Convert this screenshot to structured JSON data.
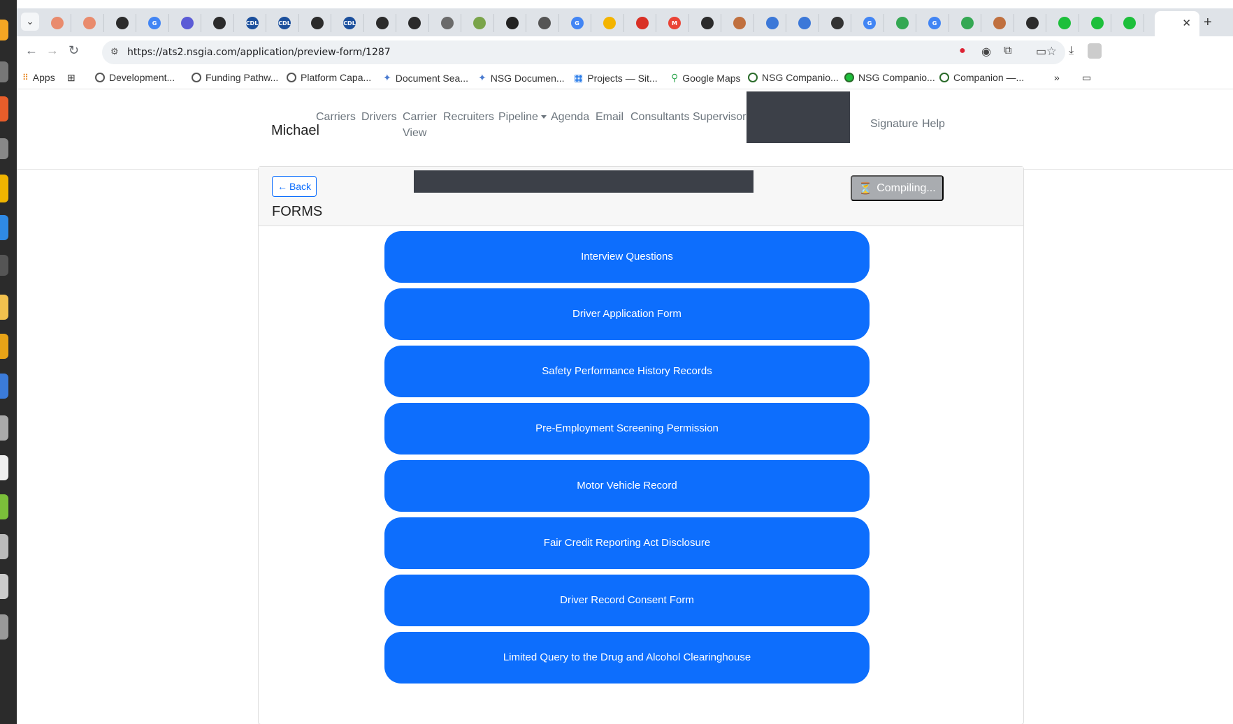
{
  "browser": {
    "tabs": [
      {
        "icon": "recording-icon",
        "color": "#e98b6d",
        "text": ""
      },
      {
        "icon": "recording-icon",
        "color": "#e98b6d",
        "text": ""
      },
      {
        "icon": "chat-icon",
        "color": "#2b2b2b",
        "text": ""
      },
      {
        "icon": "google-icon",
        "color": "#4285f4",
        "text": "G"
      },
      {
        "icon": "app-icon",
        "color": "#5b5bd6",
        "text": ""
      },
      {
        "icon": "chat-icon",
        "color": "#2b2b2b",
        "text": ""
      },
      {
        "icon": "cdl-icon",
        "color": "#1b4f9c",
        "text": "CDL"
      },
      {
        "icon": "cdl-icon",
        "color": "#1b4f9c",
        "text": "CDL"
      },
      {
        "icon": "chat-icon",
        "color": "#2b2b2b",
        "text": ""
      },
      {
        "icon": "cdl-icon",
        "color": "#1b4f9c",
        "text": "CDL"
      },
      {
        "icon": "chat-icon",
        "color": "#2b2b2b",
        "text": ""
      },
      {
        "icon": "chat-icon",
        "color": "#2b2b2b",
        "text": ""
      },
      {
        "icon": "calendar-icon",
        "color": "#6b6b6b",
        "text": ""
      },
      {
        "icon": "map-icon",
        "color": "#7aa44a",
        "text": ""
      },
      {
        "icon": "openai-icon",
        "color": "#222222",
        "text": ""
      },
      {
        "icon": "openai-icon",
        "color": "#555555",
        "text": ""
      },
      {
        "icon": "google-icon",
        "color": "#4285f4",
        "text": "G"
      },
      {
        "icon": "analytics-icon",
        "color": "#f4b400",
        "text": ""
      },
      {
        "icon": "record-icon",
        "color": "#d93025",
        "text": ""
      },
      {
        "icon": "gmail-icon",
        "color": "#ea4335",
        "text": "M"
      },
      {
        "icon": "chat-icon",
        "color": "#2b2b2b",
        "text": ""
      },
      {
        "icon": "app-icon",
        "color": "#c0703f",
        "text": ""
      },
      {
        "icon": "app-icon",
        "color": "#3c78d8",
        "text": ""
      },
      {
        "icon": "app-icon",
        "color": "#3c78d8",
        "text": ""
      },
      {
        "icon": "github-icon",
        "color": "#333333",
        "text": ""
      },
      {
        "icon": "google-icon",
        "color": "#4285f4",
        "text": "G"
      },
      {
        "icon": "maps-icon",
        "color": "#34a853",
        "text": ""
      },
      {
        "icon": "google-icon",
        "color": "#4285f4",
        "text": "G"
      },
      {
        "icon": "maps-icon",
        "color": "#34a853",
        "text": ""
      },
      {
        "icon": "app-icon",
        "color": "#c0703f",
        "text": ""
      },
      {
        "icon": "chat-icon",
        "color": "#2b2b2b",
        "text": ""
      },
      {
        "icon": "dot-icon",
        "color": "#1dbf3b",
        "text": ""
      },
      {
        "icon": "dot-icon",
        "color": "#1dbf3b",
        "text": ""
      },
      {
        "icon": "dot-icon",
        "color": "#1dbf3b",
        "text": ""
      }
    ],
    "url": "https://ats2.nsgia.com/application/preview-form/1287",
    "bookmarks": [
      {
        "label": "Apps"
      },
      {
        "label": ""
      },
      {
        "label": "Development..."
      },
      {
        "label": "Funding Pathw..."
      },
      {
        "label": "Platform Capa..."
      },
      {
        "label": "Document Sea..."
      },
      {
        "label": "NSG Documen..."
      },
      {
        "label": "Projects — Sit..."
      },
      {
        "label": "Google Maps"
      },
      {
        "label": "NSG Companio..."
      },
      {
        "label": "NSG Companio..."
      },
      {
        "label": "Companion —..."
      }
    ],
    "bookmarks_more": "»"
  },
  "navbar": {
    "brand": "Michael",
    "links": [
      "Carriers",
      "Drivers",
      "Carrier",
      "View",
      "Recruiters",
      "Pipeline",
      "Agenda",
      "Email",
      "Consultants",
      "Supervisor",
      "Signature",
      "Help"
    ]
  },
  "card": {
    "back_label": "Back",
    "title": "FORMS",
    "compile_label": "Compiling...",
    "compile_icon": "⏳"
  },
  "forms": [
    "Interview Questions",
    "Driver Application Form",
    "Safety Performance History Records",
    "Pre-Employment Screening Permission",
    "Motor Vehicle Record",
    "Fair Credit Reporting Act Disclosure",
    "Driver Record Consent Form",
    "Limited Query to the Drug and Alcohol Clearinghouse"
  ]
}
